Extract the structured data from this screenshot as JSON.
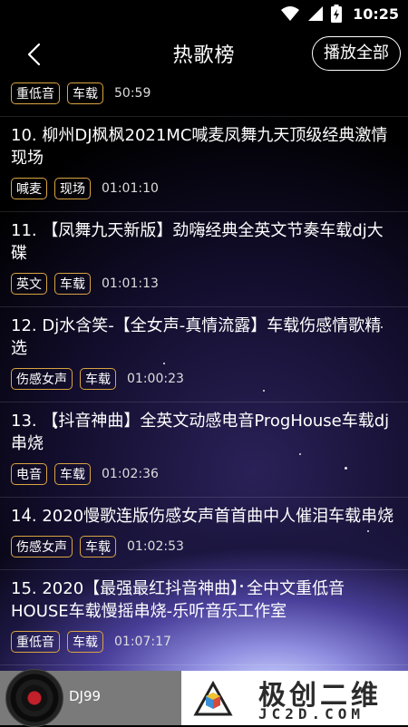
{
  "status_bar": {
    "time": "10:25"
  },
  "header": {
    "title": "热歌榜",
    "play_all": "播放全部"
  },
  "songs": [
    {
      "title": "",
      "tags": [
        "重低音",
        "车载"
      ],
      "duration": "50:59"
    },
    {
      "title": "10. 柳州DJ枫枫2021MC喊麦凤舞九天顶级经典激情现场",
      "tags": [
        "喊麦",
        "现场"
      ],
      "duration": "01:01:10"
    },
    {
      "title": "11. 【凤舞九天新版】劲嗨经典全英文节奏车载dj大碟",
      "tags": [
        "英文",
        "车载"
      ],
      "duration": "01:01:13"
    },
    {
      "title": "12. Dj水含笑-【全女声-真情流露】车载伤感情歌精选",
      "tags": [
        "伤感女声",
        "车载"
      ],
      "duration": "01:00:23"
    },
    {
      "title": "13. 【抖音神曲】全英文动感电音ProgHouse车载dj串烧",
      "tags": [
        "电音",
        "车载"
      ],
      "duration": "01:02:36"
    },
    {
      "title": "14. 2020慢歌连版伤感女声首首曲中人催泪车载串烧",
      "tags": [
        "伤感女声",
        "车载"
      ],
      "duration": "01:02:53"
    },
    {
      "title": "15. 2020【最强最红抖音神曲】全中文重低音HOUSE车载慢摇串烧-乐听音乐工作室",
      "tags": [
        "重低音",
        "车载"
      ],
      "duration": "01:07:17"
    }
  ],
  "player": {
    "name": "DJ99"
  },
  "watermark": {
    "title": "极创二维",
    "subtitle": "JC2D.COM"
  },
  "colors": {
    "tag_border": "#d9a441",
    "background": "#000000"
  }
}
